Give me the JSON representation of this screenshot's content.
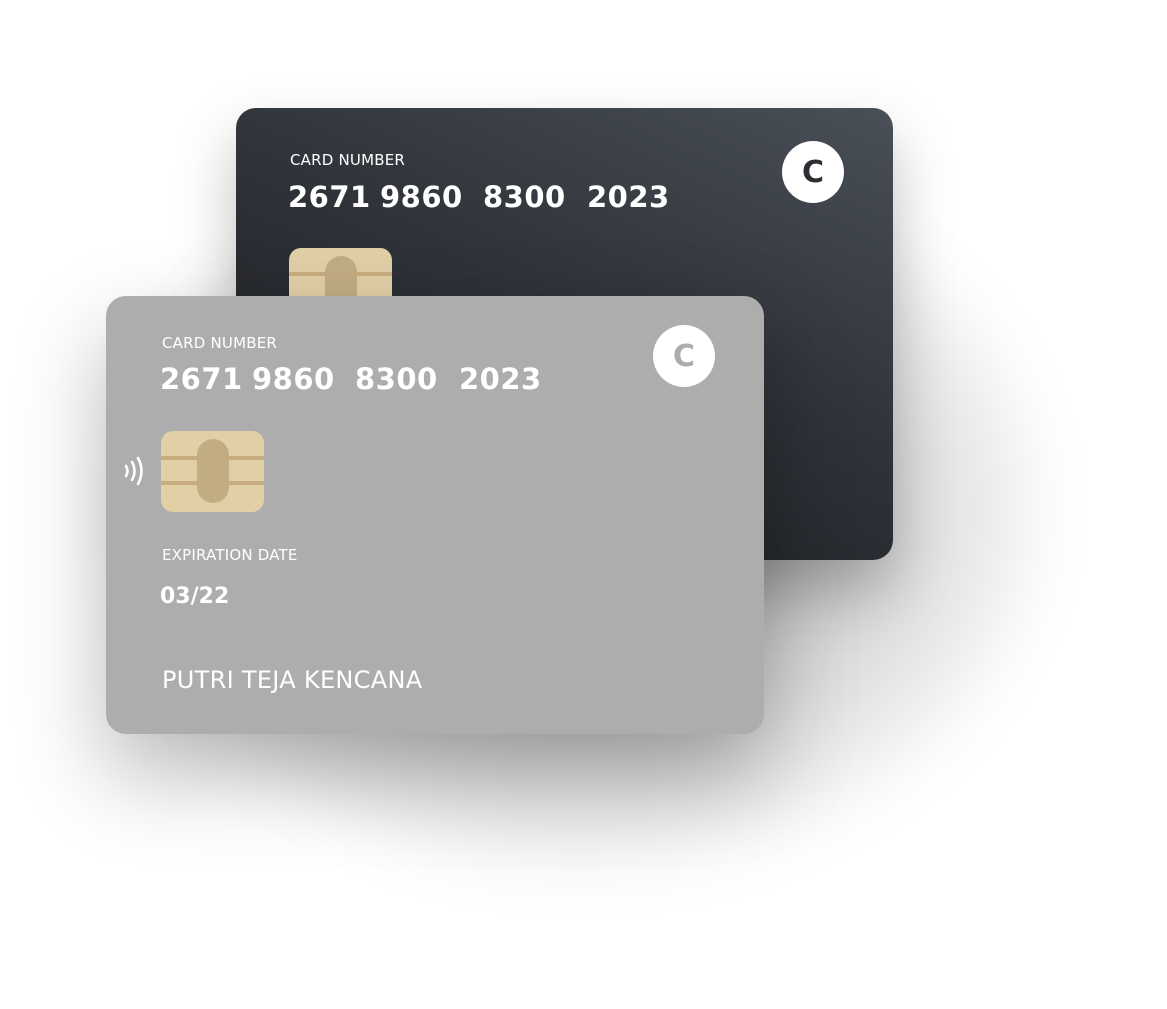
{
  "back_card": {
    "card_number_label": "CARD NUMBER",
    "number_groups": [
      "2671",
      "9860",
      "8300",
      "2023"
    ],
    "logo_letter": "C",
    "gradient_colors": [
      "#4a5058",
      "#1e1f23"
    ]
  },
  "front_card": {
    "card_number_label": "CARD NUMBER",
    "number_groups": [
      "2671",
      "9860",
      "8300",
      "2023"
    ],
    "logo_letter": "C",
    "expiration_label": "EXPIRATION DATE",
    "expiration_value": "03/22",
    "holder_name": "PUTRI TEJA KENCANA",
    "background_color": "#adadad"
  },
  "icons": {
    "chip": "chip-icon",
    "contactless": "contactless-icon",
    "logo": "brand-logo-icon"
  },
  "colors": {
    "chip_gold": "#e1cfa6",
    "chip_line": "#c7ad7e",
    "text": "#ffffff"
  }
}
